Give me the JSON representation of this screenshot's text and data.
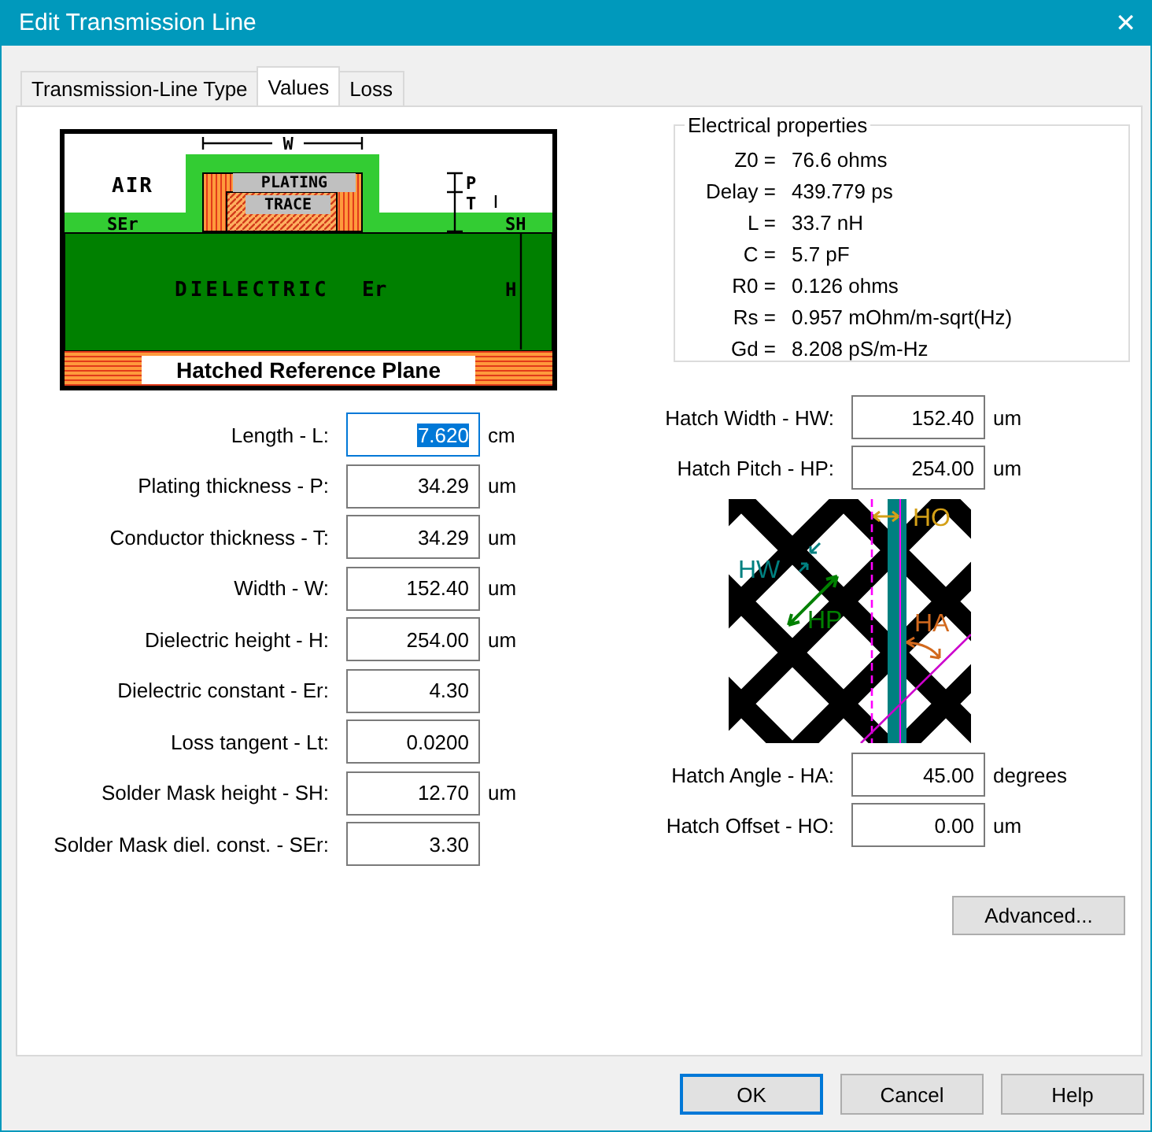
{
  "window": {
    "title": "Edit Transmission Line",
    "close": "✕"
  },
  "tabs": [
    {
      "label": "Transmission-Line Type",
      "selected": false
    },
    {
      "label": "Values",
      "selected": true
    },
    {
      "label": "Loss",
      "selected": false
    }
  ],
  "cross_section": {
    "width": "W",
    "air": "AIR",
    "plating": "PLATING",
    "trace": "TRACE",
    "plating_thickness": "P",
    "trace_thickness": "T",
    "mask_er": "SEr",
    "mask_height": "SH",
    "dielectric": "DIELECTRIC",
    "er": "Er",
    "height": "H",
    "plane": "Hatched Reference Plane"
  },
  "electrical_properties": {
    "title": "Electrical properties",
    "rows": [
      {
        "label": "Z0 =",
        "value": "76.6 ohms"
      },
      {
        "label": "Delay =",
        "value": "439.779 ps"
      },
      {
        "label": "L =",
        "value": "33.7 nH"
      },
      {
        "label": "C =",
        "value": "5.7 pF"
      },
      {
        "label": "R0 =",
        "value": "0.126 ohms"
      },
      {
        "label": "Rs =",
        "value": "0.957 mOhm/m-sqrt(Hz)"
      },
      {
        "label": "Gd =",
        "value": "8.208 pS/m-Hz"
      }
    ]
  },
  "parameters": [
    {
      "label": "Length - L:",
      "value": "7.620",
      "unit": "cm",
      "focused": true
    },
    {
      "label": "Plating thickness - P:",
      "value": "34.29",
      "unit": "um",
      "focused": false
    },
    {
      "label": "Conductor thickness - T:",
      "value": "34.29",
      "unit": "um",
      "focused": false
    },
    {
      "label": "Width - W:",
      "value": "152.40",
      "unit": "um",
      "focused": false
    },
    {
      "label": "Dielectric height - H:",
      "value": "254.00",
      "unit": "um",
      "focused": false
    },
    {
      "label": "Dielectric constant - Er:",
      "value": "4.30",
      "focused": false
    },
    {
      "label": "Loss tangent - Lt:",
      "value": "0.0200",
      "focused": false
    },
    {
      "label": "Solder Mask height - SH:",
      "value": "12.70",
      "unit": "um",
      "focused": false
    },
    {
      "label": "Solder Mask diel. const. - SEr:",
      "value": "3.30",
      "focused": false
    }
  ],
  "hatch_parameters_top": [
    {
      "label": "Hatch Width - HW:",
      "value": "152.40",
      "unit": "um",
      "focused": false
    },
    {
      "label": "Hatch Pitch - HP:",
      "value": "254.00",
      "unit": "um",
      "focused": false
    }
  ],
  "hatch_drawing": {
    "offset": "HO",
    "width": "HW",
    "pitch": "HP",
    "angle": "HA"
  },
  "hatch_parameters_bottom": [
    {
      "label": "Hatch Angle - HA:",
      "value": "45.00",
      "unit": "degrees",
      "focused": false
    },
    {
      "label": "Hatch Offset - HO:",
      "value": "0.00",
      "unit": "um",
      "focused": false
    }
  ],
  "advanced_button": "Advanced...",
  "buttons": [
    {
      "label": "OK",
      "default": true
    },
    {
      "label": "Cancel",
      "default": false
    },
    {
      "label": "Help",
      "default": false
    }
  ]
}
